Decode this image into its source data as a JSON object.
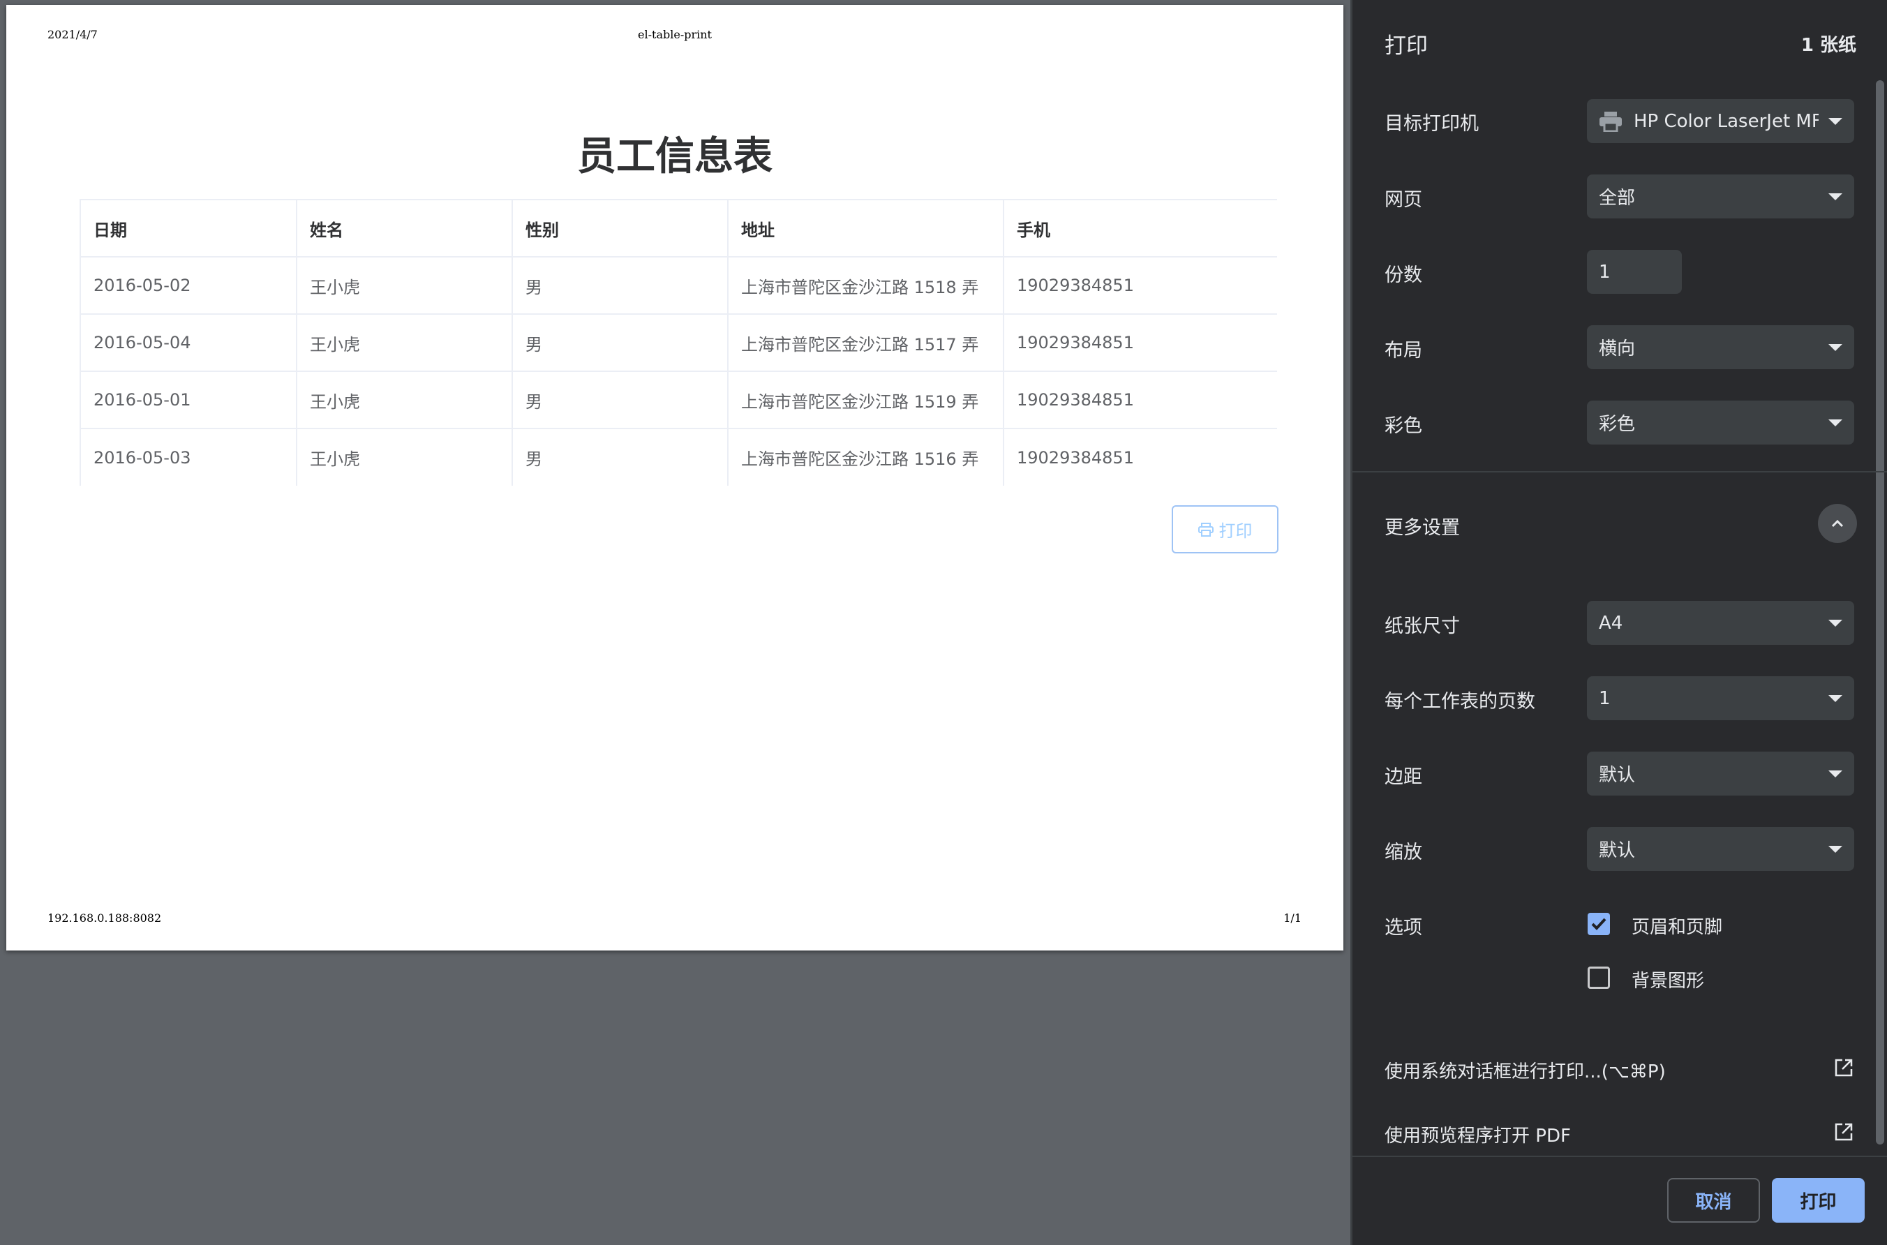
{
  "preview": {
    "header_date": "2021/4/7",
    "header_title": "el-table-print",
    "footer_url": "192.168.0.188:8082",
    "footer_pages": "1/1",
    "doc_title": "员工信息表",
    "columns": [
      "日期",
      "姓名",
      "性别",
      "地址",
      "手机"
    ],
    "rows": [
      [
        "2016-05-02",
        "王小虎",
        "男",
        "上海市普陀区金沙江路 1518 弄",
        "19029384851"
      ],
      [
        "2016-05-04",
        "王小虎",
        "男",
        "上海市普陀区金沙江路 1517 弄",
        "19029384851"
      ],
      [
        "2016-05-01",
        "王小虎",
        "男",
        "上海市普陀区金沙江路 1519 弄",
        "19029384851"
      ],
      [
        "2016-05-03",
        "王小虎",
        "男",
        "上海市普陀区金沙江路 1516 弄",
        "19029384851"
      ]
    ],
    "print_button_label": "打印",
    "print_button_icon": "printer-icon"
  },
  "panel": {
    "title": "打印",
    "sheet_count": "1 张纸",
    "destination": {
      "label": "目标打印机",
      "value": "HP Color LaserJet MFP",
      "icon": "printer-icon"
    },
    "pages": {
      "label": "网页",
      "value": "全部"
    },
    "copies": {
      "label": "份数",
      "value": "1"
    },
    "layout": {
      "label": "布局",
      "value": "横向"
    },
    "color": {
      "label": "彩色",
      "value": "彩色"
    },
    "more_settings": {
      "label": "更多设置",
      "icon": "chevron-up-icon"
    },
    "paper_size": {
      "label": "纸张尺寸",
      "value": "A4"
    },
    "pages_per_sheet": {
      "label": "每个工作表的页数",
      "value": "1"
    },
    "margins": {
      "label": "边距",
      "value": "默认"
    },
    "scale": {
      "label": "缩放",
      "value": "默认"
    },
    "options": {
      "label": "选项",
      "header_footer": {
        "label": "页眉和页脚",
        "checked": true
      },
      "background_graphics": {
        "label": "背景图形",
        "checked": false
      }
    },
    "system_dialog_link": "使用系统对话框进行打印...(⌥⌘P)",
    "open_pdf_link": "使用预览程序打开 PDF",
    "cancel_label": "取消",
    "print_label": "打印"
  },
  "colors": {
    "panel_bg": "#292a2d",
    "field_bg": "#3c4043",
    "accent": "#8ab4f8",
    "preview_bg": "#5f6368"
  }
}
